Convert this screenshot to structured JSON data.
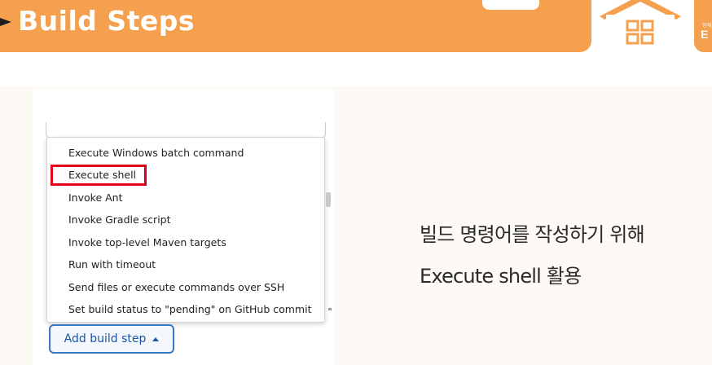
{
  "header": {
    "title": "Build Steps",
    "logo_small": "함께",
    "logo_text": "E",
    "colors": {
      "accent": "#f5a04f",
      "text": "#ffffff"
    }
  },
  "menu": {
    "items": [
      {
        "label": "Execute Windows batch command"
      },
      {
        "label": "Execute shell",
        "highlighted": true
      },
      {
        "label": "Invoke Ant"
      },
      {
        "label": "Invoke Gradle script"
      },
      {
        "label": "Invoke top-level Maven targets"
      },
      {
        "label": "Run with timeout"
      },
      {
        "label": "Send files or execute commands over SSH"
      },
      {
        "label": "Set build status to \"pending\" on GitHub commit"
      }
    ],
    "highlight_color": "#e3001b"
  },
  "add_button": {
    "label": "Add build step",
    "icon": "caret-up-icon",
    "color": "#3876c8"
  },
  "description": {
    "line1": "빌드 명령어를 작성하기 위해",
    "line2": "Execute shell 활용"
  }
}
